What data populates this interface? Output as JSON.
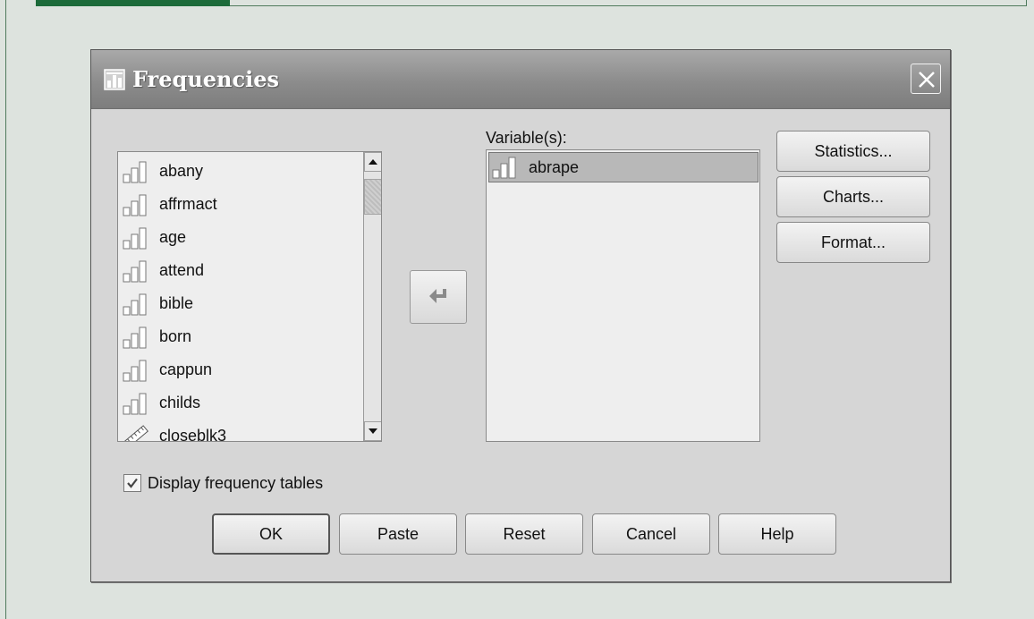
{
  "window": {
    "title": "Frequencies"
  },
  "source_list": {
    "items": [
      {
        "label": "abany",
        "icon": "ordinal-icon"
      },
      {
        "label": "affrmact",
        "icon": "ordinal-icon"
      },
      {
        "label": "age",
        "icon": "ordinal-icon"
      },
      {
        "label": "attend",
        "icon": "ordinal-icon"
      },
      {
        "label": "bible",
        "icon": "ordinal-icon"
      },
      {
        "label": "born",
        "icon": "ordinal-icon"
      },
      {
        "label": "cappun",
        "icon": "ordinal-icon"
      },
      {
        "label": "childs",
        "icon": "ordinal-icon"
      },
      {
        "label": "closeblk3",
        "icon": "scale-ruler-icon"
      }
    ]
  },
  "target": {
    "label": "Variable(s):",
    "items": [
      {
        "label": "abrape",
        "icon": "ordinal-icon"
      }
    ]
  },
  "side_buttons": {
    "statistics": "Statistics...",
    "charts": "Charts...",
    "format": "Format..."
  },
  "options": {
    "display_frequency_tables": {
      "label": "Display frequency tables",
      "checked": true
    }
  },
  "bottom_buttons": {
    "ok": "OK",
    "paste": "Paste",
    "reset": "Reset",
    "cancel": "Cancel",
    "help": "Help"
  }
}
